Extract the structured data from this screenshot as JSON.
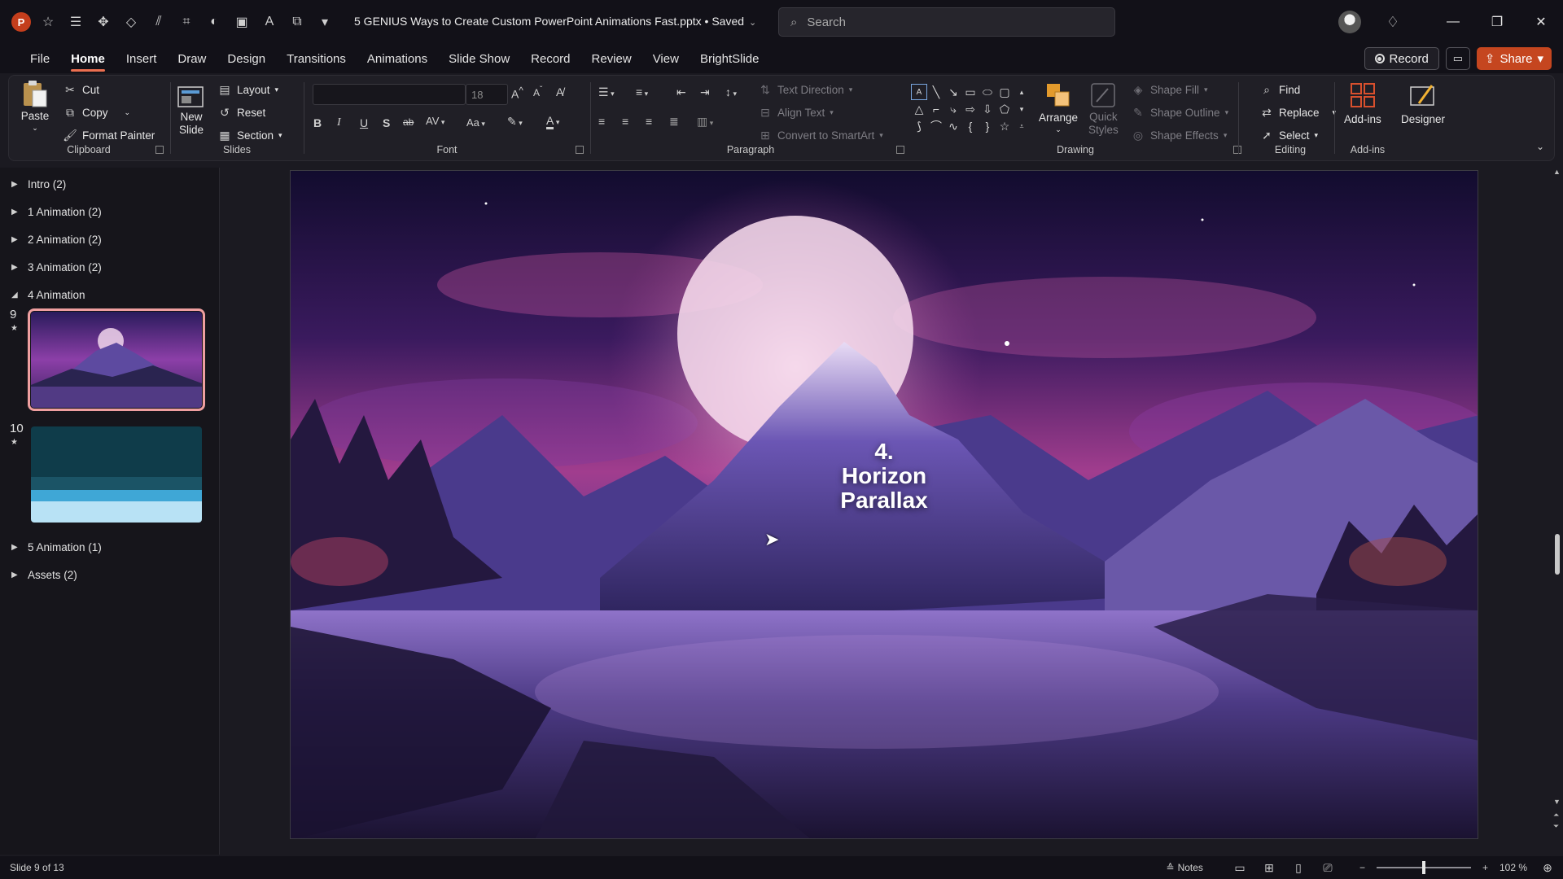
{
  "window": {
    "title": "5 GENIUS Ways to Create Custom PowerPoint Animations Fast.pptx • Saved",
    "app_logo": "P",
    "search_placeholder": "Search",
    "quick_access_icons": [
      "autosave-star-icon",
      "outline-icon",
      "center-icon",
      "format-icon",
      "align-icon",
      "crop-icon",
      "shape-fill-icon",
      "picture-icon",
      "text-icon",
      "slideshow-icon",
      "customize-icon"
    ]
  },
  "menu": {
    "tabs": [
      "File",
      "Home",
      "Insert",
      "Draw",
      "Design",
      "Transitions",
      "Animations",
      "Slide Show",
      "Record",
      "Review",
      "View",
      "BrightSlide"
    ],
    "active_tab": "Home",
    "record_label": "Record",
    "share_label": "Share"
  },
  "ribbon": {
    "clipboard": {
      "label": "Clipboard",
      "paste": "Paste",
      "cut": "Cut",
      "copy": "Copy",
      "format_painter": "Format Painter"
    },
    "slides": {
      "label": "Slides",
      "new_slide_line1": "New",
      "new_slide_line2": "Slide",
      "layout": "Layout",
      "reset": "Reset",
      "section": "Section"
    },
    "font": {
      "label": "Font",
      "font_size": "18",
      "bold": "B",
      "italic": "I",
      "underline": "U",
      "shadow": "S",
      "strike": "ab",
      "spacing": "AV",
      "case": "Aa",
      "grow": "A",
      "shrink": "A",
      "font_color": "A"
    },
    "paragraph": {
      "label": "Paragraph",
      "text_direction": "Text Direction",
      "align_text": "Align Text",
      "convert_smartart": "Convert to SmartArt"
    },
    "drawing": {
      "label": "Drawing",
      "arrange": "Arrange",
      "quick_styles_line1": "Quick",
      "quick_styles_line2": "Styles",
      "shape_fill": "Shape Fill",
      "shape_outline": "Shape Outline",
      "shape_effects": "Shape Effects"
    },
    "editing": {
      "label": "Editing",
      "find": "Find",
      "replace": "Replace",
      "select": "Select"
    },
    "addins": {
      "label": "Add-ins",
      "addins_btn": "Add-ins",
      "designer": "Designer"
    }
  },
  "sections": [
    {
      "name": "Intro (2)",
      "expanded": false
    },
    {
      "name": "1 Animation (2)",
      "expanded": false
    },
    {
      "name": "2 Animation (2)",
      "expanded": false
    },
    {
      "name": "3 Animation (2)",
      "expanded": false
    },
    {
      "name": "4 Animation",
      "expanded": true
    },
    {
      "name": "5 Animation (1)",
      "expanded": false
    },
    {
      "name": "Assets (2)",
      "expanded": false
    }
  ],
  "thumbnails": [
    {
      "number": "9",
      "selected": true
    },
    {
      "number": "10",
      "selected": false
    }
  ],
  "slide": {
    "title_line1": "4.",
    "title_line2": "Horizon",
    "title_line3": "Parallax"
  },
  "status": {
    "slide_info": "Slide 9 of 13",
    "notes": "Notes",
    "zoom": "102 %",
    "zoom_minus": "−",
    "zoom_plus": "+"
  },
  "colors": {
    "accent": "#ec6f50",
    "share": "#c5461f",
    "selected_thumb_outline": "#ef9fa0",
    "app_logo": "#c43e1c"
  }
}
